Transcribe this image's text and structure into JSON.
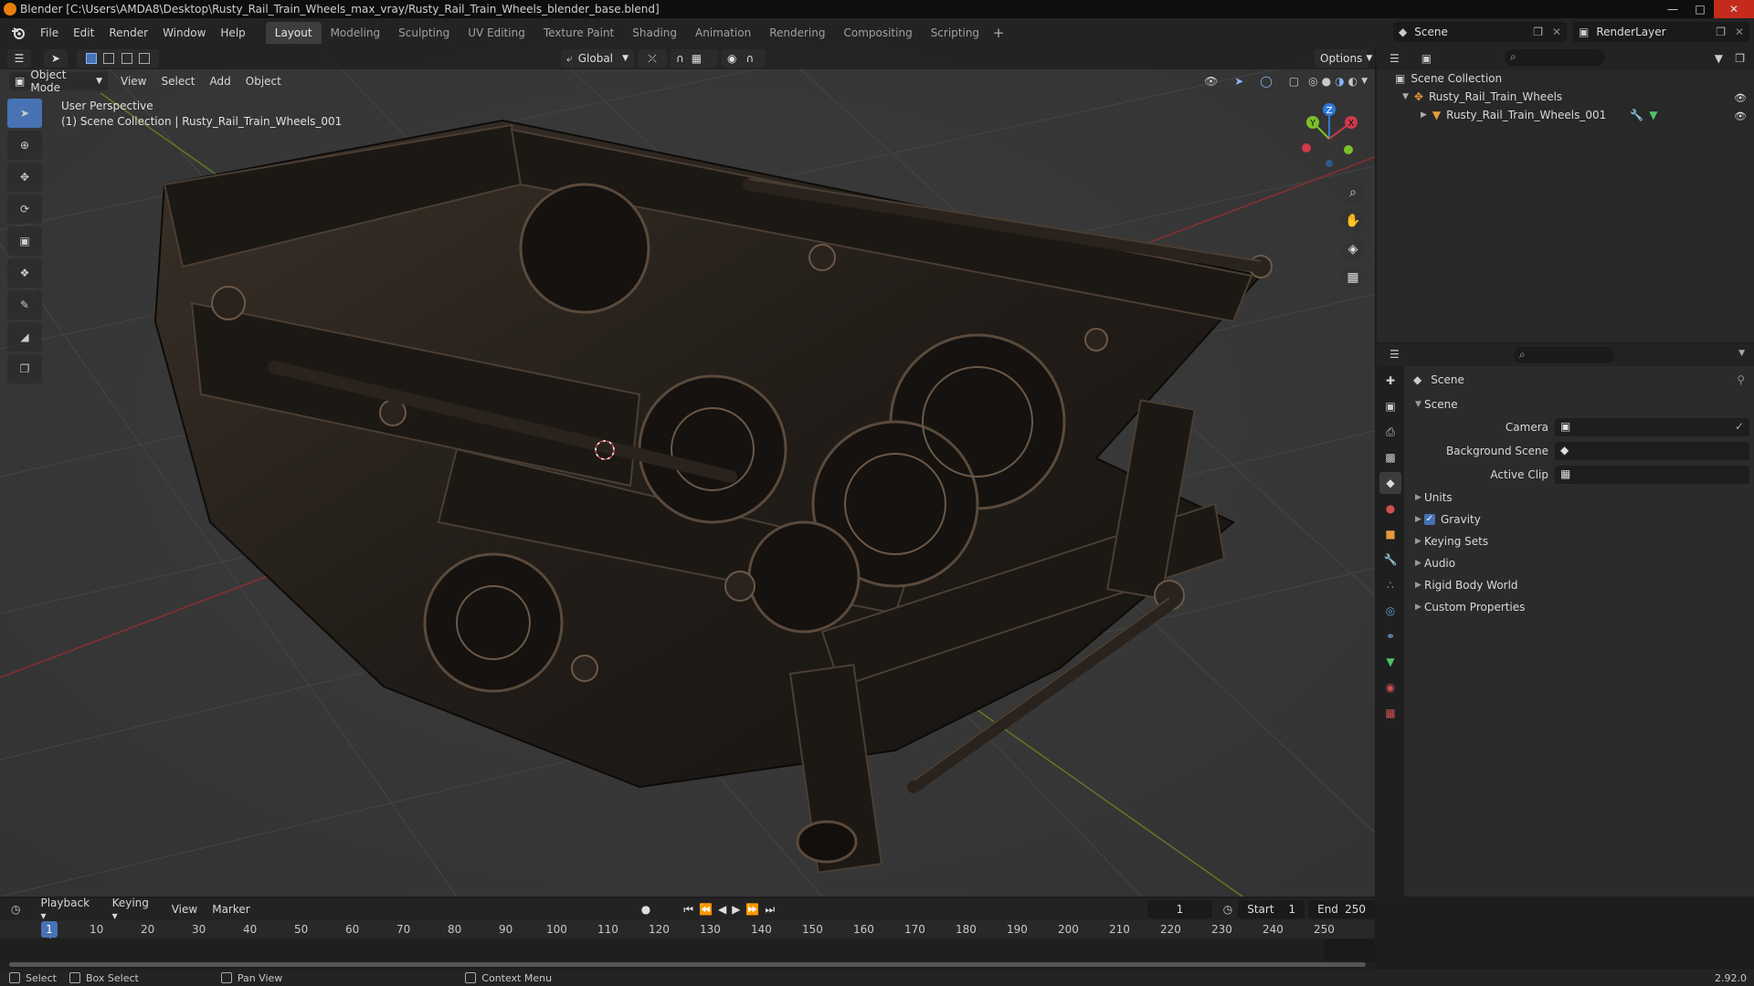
{
  "window": {
    "title": "Blender [C:\\Users\\AMDA8\\Desktop\\Rusty_Rail_Train_Wheels_max_vray/Rusty_Rail_Train_Wheels_blender_base.blend]",
    "controls": [
      "minimize-icon",
      "maximize-icon",
      "close-icon"
    ]
  },
  "menubar": {
    "items": [
      "File",
      "Edit",
      "Render",
      "Window",
      "Help"
    ]
  },
  "workspaces": {
    "tabs": [
      "Layout",
      "Modeling",
      "Sculpting",
      "UV Editing",
      "Texture Paint",
      "Shading",
      "Animation",
      "Rendering",
      "Compositing",
      "Scripting"
    ],
    "active": "Layout"
  },
  "scene_selector": {
    "value": "Scene"
  },
  "renderlayer_selector": {
    "value": "RenderLayer"
  },
  "viewport": {
    "transform_orientation": "Global",
    "options_label": "Options",
    "mode": "Object Mode",
    "menus": [
      "View",
      "Select",
      "Add",
      "Object"
    ],
    "overlay_line1": "User Perspective",
    "overlay_line2": "(1) Scene Collection | Rusty_Rail_Train_Wheels_001",
    "gizmo_axes": [
      "X",
      "Y",
      "Z"
    ],
    "colors": {
      "x_axis": "#d13a4a",
      "y_axis": "#7ac02b",
      "z_axis": "#2f7bd9",
      "active_tool": "#4772b3"
    }
  },
  "outliner": {
    "root": "Scene Collection",
    "collection": "Rusty_Rail_Train_Wheels",
    "object": "Rusty_Rail_Train_Wheels_001"
  },
  "properties": {
    "context": "Scene",
    "panel_title": "Scene",
    "fields": [
      {
        "label": "Camera"
      },
      {
        "label": "Background Scene"
      },
      {
        "label": "Active Clip"
      }
    ],
    "sections": [
      "Units",
      "Gravity",
      "Keying Sets",
      "Audio",
      "Rigid Body World",
      "Custom Properties"
    ],
    "gravity_checked": true
  },
  "timeline": {
    "menus": [
      "Playback",
      "Keying",
      "View",
      "Marker"
    ],
    "current_frame": "1",
    "start_label": "Start",
    "start_value": "1",
    "end_label": "End",
    "end_value": "250",
    "ruler": [
      "1",
      "10",
      "20",
      "30",
      "40",
      "50",
      "60",
      "70",
      "80",
      "90",
      "100",
      "110",
      "120",
      "130",
      "140",
      "150",
      "160",
      "170",
      "180",
      "190",
      "200",
      "210",
      "220",
      "230",
      "240",
      "250"
    ]
  },
  "statusbar": {
    "items": [
      "Select",
      "Box Select",
      "Pan View",
      "Context Menu"
    ],
    "version": "2.92.0"
  }
}
